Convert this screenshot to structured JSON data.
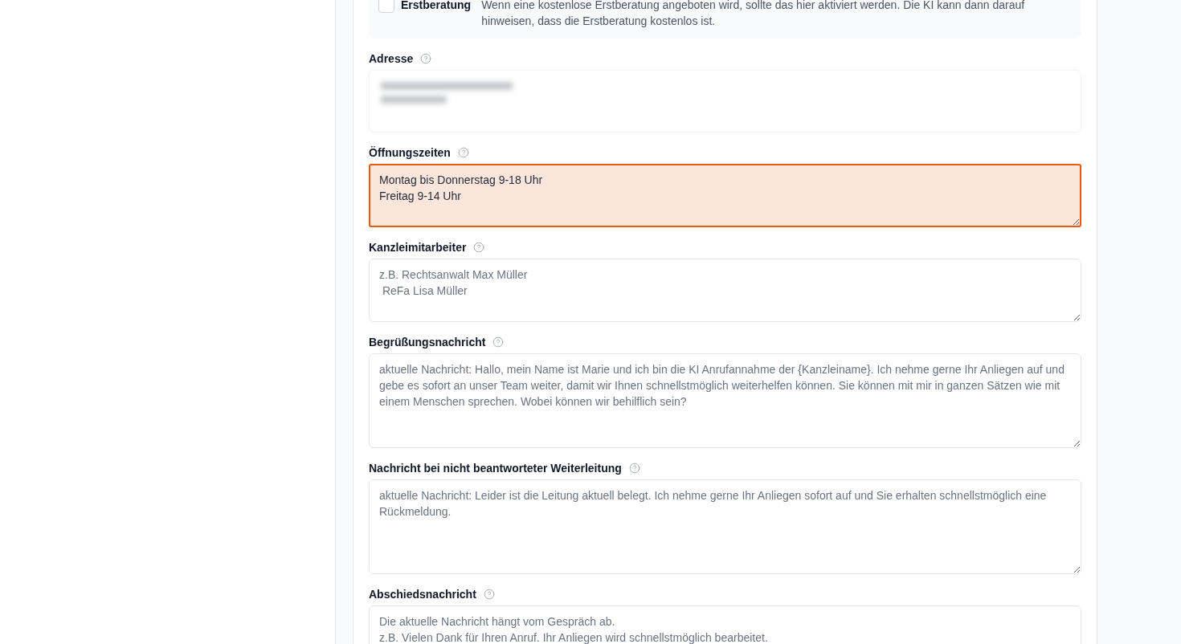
{
  "consultation_option": {
    "label": "Erstberatung",
    "checked": false,
    "description": "Wenn eine kostenlose Erstberatung angeboten wird, sollte das hier aktiviert werden. Die KI kann dann darauf hinweisen, dass die Erstberatung kostenlos ist."
  },
  "fields": [
    {
      "kind": "redacted",
      "label": "Adresse"
    },
    {
      "kind": "short_text",
      "label": "Öffnungszeiten",
      "value": "Montag bis Donnerstag 9-18 Uhr\nFreitag 9-14 Uhr",
      "highlighted": true
    },
    {
      "kind": "short_text",
      "label": "Kanzleimitarbeiter",
      "placeholder": "z.B. Rechtsanwalt Max Müller\n ReFa Lisa Müller",
      "highlighted": false
    },
    {
      "kind": "long_text",
      "label": "Begrüßungsnachricht",
      "placeholder": "aktuelle Nachricht: Hallo, mein Name ist Marie und ich bin die KI Anrufannahme der {Kanzleiname}. Ich nehme gerne Ihr Anliegen auf und gebe es sofort an unser Team weiter, damit wir Ihnen schnellstmöglich weiterhelfen können. Sie können mit mir in ganzen Sätzen wie mit einem Menschen sprechen. Wobei können wir behilflich sein?",
      "highlighted": false
    },
    {
      "kind": "long_text",
      "label": "Nachricht bei nicht beantworteter Weiterleitung",
      "placeholder": "aktuelle Nachricht: Leider ist die Leitung aktuell belegt. Ich nehme gerne Ihr Anliegen sofort auf und Sie erhalten schnellstmöglich eine Rückmeldung.",
      "highlighted": false
    },
    {
      "kind": "long_text",
      "label": "Abschiedsnachricht",
      "placeholder": "Die aktuelle Nachricht hängt vom Gespräch ab.\nz.B. Vielen Dank für Ihren Anruf. Ihr Anliegen wird schnellstmöglich bearbeitet.",
      "highlighted": false
    }
  ]
}
